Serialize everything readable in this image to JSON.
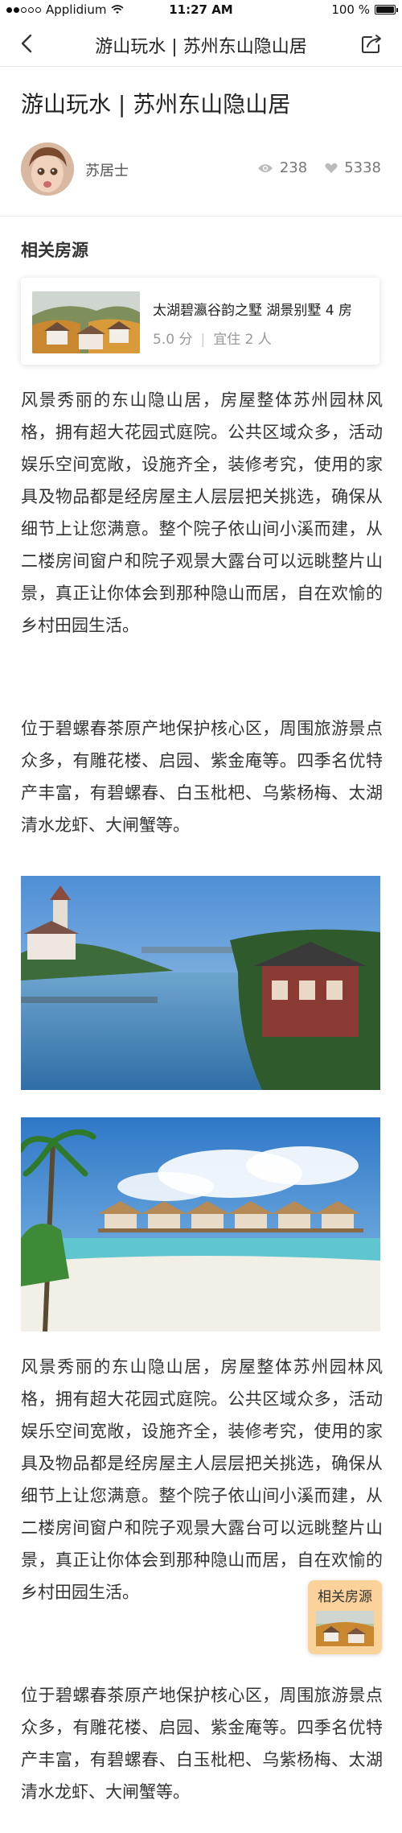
{
  "status_bar": {
    "carrier": "Applidium",
    "time": "11:27 AM",
    "battery": "100 %"
  },
  "nav": {
    "title": "游山玩水 | 苏州东山隐山居",
    "back_icon": "chevron-left-icon",
    "share_icon": "share-icon"
  },
  "article": {
    "title": "游山玩水 | 苏州东山隐山居",
    "author": {
      "name": "苏居士",
      "avatar": "avatar-photo"
    },
    "stats": {
      "views": "238",
      "likes": "5338"
    }
  },
  "related": {
    "section_title": "相关房源",
    "listing": {
      "name": "太湖碧瀛谷韵之墅 湖景别墅 4 房",
      "rating": "5.0 分",
      "capacity": "宜住 2 人"
    },
    "float_label": "相关房源"
  },
  "content": {
    "paragraphs": [
      "风景秀丽的东山隐山居，房屋整体苏州园林风格，拥有超大花园式庭院。公共区域众多，活动娱乐空间宽敞，设施齐全，装修考究，使用的家具及物品都是经房屋主人层层把关挑选，确保从细节上让您满意。整个院子依山间小溪而建，从二楼房间窗户和院子观景大露台可以远眺整片山景，真正让你体会到那种隐山而居，自在欢愉的乡村田园生活。",
      "位于碧螺春茶原产地保护核心区，周围旅游景点众多，有雕花楼、启园、紫金庵等。四季名优特产丰富，有碧螺春、白玉枇杷、乌紫杨梅、太湖清水龙虾、大闸蟹等。",
      "风景秀丽的东山隐山居，房屋整体苏州园林风格，拥有超大花园式庭院。公共区域众多，活动娱乐空间宽敞，设施齐全，装修考究，使用的家具及物品都是经房屋主人层层把关挑选，确保从细节上让您满意。整个院子依山间小溪而建，从二楼房间窗户和院子观景大露台可以远眺整片山景，真正让你体会到那种隐山而居，自在欢愉的乡村田园生活。",
      "位于碧螺春茶原产地保护核心区，周围旅游景点众多，有雕花楼、启园、紫金庵等。四季名优特产丰富，有碧螺春、白玉枇杷、乌紫杨梅、太湖清水龙虾、大闸蟹等。"
    ],
    "photos": [
      "lake-village-photo",
      "beach-bungalow-photo"
    ]
  },
  "colors": {
    "float_badge": "#fbd39a",
    "text": "#333333",
    "muted": "#999999"
  }
}
